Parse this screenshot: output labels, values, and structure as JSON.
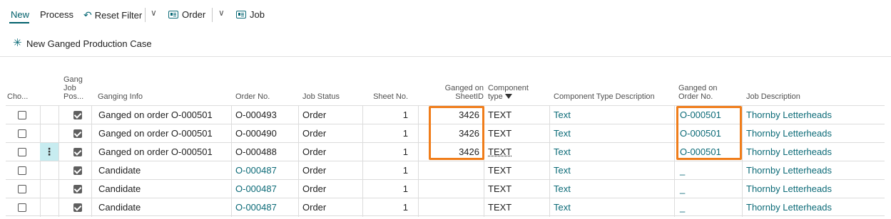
{
  "actions": {
    "new": "New",
    "process": "Process",
    "reset_filter": "Reset Filter",
    "order": "Order",
    "job": "Job"
  },
  "subbar": {
    "new_case": "New Ganged Production Case"
  },
  "columns": {
    "choose": "Cho...",
    "gang_pos_1": "Gang",
    "gang_pos_2": "Job",
    "gang_pos_3": "Pos...",
    "ganging_info": "Ganging Info",
    "order_no": "Order No.",
    "job_status": "Job Status",
    "sheet_no": "Sheet No.",
    "ganged_sheet_1": "Ganged on",
    "ganged_sheet_2": "SheetID",
    "component_type_1": "Component",
    "component_type_2": "type",
    "component_desc": "Component Type Description",
    "ganged_order_1": "Ganged on",
    "ganged_order_2": "Order No.",
    "job_desc": "Job Description"
  },
  "rows": [
    {
      "choose": false,
      "gang_pos": true,
      "ganging_info": "Ganged on order O-000501",
      "order_no": "O-000493",
      "job_status": "Order",
      "sheet_no": "1",
      "ganged_sheet": "3426",
      "component_type": "TEXT",
      "component_desc": "Text",
      "ganged_order": "O-000501",
      "job_desc": "Thornby Letterheads"
    },
    {
      "choose": false,
      "gang_pos": true,
      "ganging_info": "Ganged on order O-000501",
      "order_no": "O-000490",
      "job_status": "Order",
      "sheet_no": "1",
      "ganged_sheet": "3426",
      "component_type": "TEXT",
      "component_desc": "Text",
      "ganged_order": "O-000501",
      "job_desc": "Thornby Letterheads"
    },
    {
      "choose": false,
      "gang_pos": true,
      "ganging_info": "Ganged on order O-000501",
      "order_no": "O-000488",
      "job_status": "Order",
      "sheet_no": "1",
      "ganged_sheet": "3426",
      "component_type": "TEXT",
      "component_desc": "Text",
      "ganged_order": "O-000501",
      "job_desc": "Thornby Letterheads"
    },
    {
      "choose": false,
      "gang_pos": true,
      "ganging_info": "Candidate",
      "order_no": "O-000487",
      "job_status": "Order",
      "sheet_no": "1",
      "ganged_sheet": "",
      "component_type": "TEXT",
      "component_desc": "Text",
      "ganged_order": "_",
      "job_desc": "Thornby Letterheads"
    },
    {
      "choose": false,
      "gang_pos": true,
      "ganging_info": "Candidate",
      "order_no": "O-000487",
      "job_status": "Order",
      "sheet_no": "1",
      "ganged_sheet": "",
      "component_type": "TEXT",
      "component_desc": "Text",
      "ganged_order": "_",
      "job_desc": "Thornby Letterheads"
    },
    {
      "choose": false,
      "gang_pos": true,
      "ganging_info": "Candidate",
      "order_no": "O-000487",
      "job_status": "Order",
      "sheet_no": "1",
      "ganged_sheet": "",
      "component_type": "TEXT",
      "component_desc": "Text",
      "ganged_order": "_",
      "job_desc": "Thornby Letterheads"
    }
  ],
  "colors": {
    "accent": "#0b6a77",
    "highlight": "#f07d1a",
    "context_bg": "#c7ecf0"
  },
  "icons": {
    "reset": "undo-arrow-icon",
    "order": "table-view-icon",
    "job": "table-view-icon",
    "new_case": "asterisk-new-icon",
    "filter": "filter-funnel-icon",
    "context_menu": "vertical-ellipsis-icon"
  }
}
